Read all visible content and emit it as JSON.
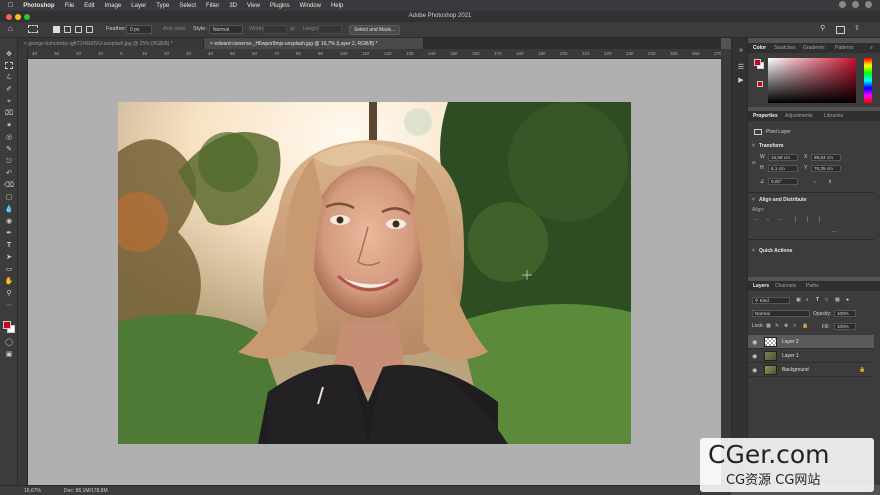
{
  "menubar": {
    "items": [
      "Photoshop",
      "File",
      "Edit",
      "Image",
      "Layer",
      "Type",
      "Select",
      "Filter",
      "3D",
      "View",
      "Plugins",
      "Window",
      "Help"
    ]
  },
  "titlebar": {
    "title": "Adobe Photoshop 2021"
  },
  "options": {
    "feather_label": "Feather:",
    "feather_value": "0 px",
    "antialias_label": "Anti-alias",
    "style_label": "Style:",
    "style_value": "Normal",
    "width_label": "Width:",
    "height_label": "Height:",
    "select_mask_label": "Select and Mask..."
  },
  "tabs": [
    {
      "label": "george-bohunicky-qjKT2rMU0VU-unsplash.jpg @ 25% (RGB/8) *"
    },
    {
      "label": "edward-cisneros-_H6wpor9mjs-unsplash.jpg @ 16,7% (Layer 2, RGB/8) *"
    }
  ],
  "ruler": {
    "ticks": [
      "40",
      "30",
      "20",
      "10",
      "0",
      "10",
      "20",
      "30",
      "40",
      "50",
      "60",
      "70",
      "80",
      "90",
      "100",
      "110",
      "120",
      "130",
      "140",
      "150",
      "160",
      "170",
      "180",
      "190",
      "200",
      "210",
      "220",
      "230",
      "240",
      "250",
      "260",
      "270"
    ]
  },
  "color_panel": {
    "tabs": [
      "Color",
      "Swatches",
      "Gradients",
      "Patterns"
    ],
    "hue_color": "#c8102e"
  },
  "properties_panel": {
    "tabs": [
      "Properties",
      "Adjustments",
      "Libraries"
    ],
    "kind": "Pixel Layer",
    "transform_title": "Transform",
    "w_label": "W",
    "w_value": "16,58 cm",
    "x_label": "X",
    "x_value": "69,64 cm",
    "h_label": "H",
    "h_value": "6,1 cm",
    "y_label": "Y",
    "y_value": "76,35 cm",
    "angle_value": "0,00°",
    "align_title": "Align and Distribute",
    "align_label": "Align:",
    "quick_title": "Quick Actions"
  },
  "layers_panel": {
    "tabs": [
      "Layers",
      "Channels",
      "Paths"
    ],
    "kind_label": "Kind",
    "blend_mode": "Normal",
    "opacity_label": "Opacity:",
    "opacity_value": "100%",
    "lock_label": "Lock:",
    "fill_label": "Fill:",
    "fill_value": "100%",
    "layers": [
      {
        "name": "Layer 2",
        "selected": true
      },
      {
        "name": "Layer 1",
        "selected": false
      },
      {
        "name": "Background",
        "selected": false
      }
    ]
  },
  "status": {
    "zoom": "16,67%",
    "doc": "Doc: 86,1M/178,8M"
  },
  "watermark": {
    "line1": "CGer.com",
    "line2": "CG资源 CG网站"
  }
}
